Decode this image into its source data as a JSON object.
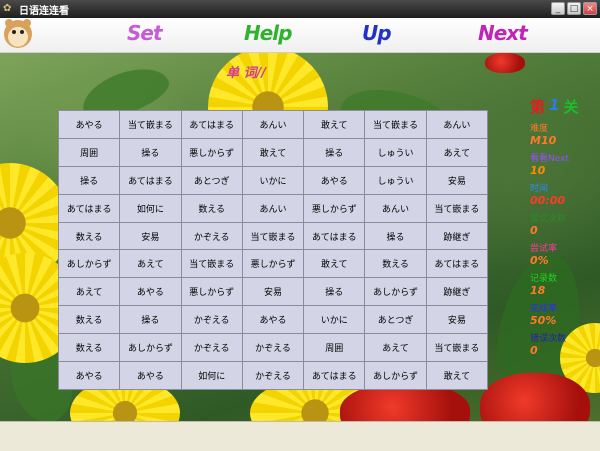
{
  "window": {
    "title": "日语连连看"
  },
  "menu": {
    "set": "Set",
    "help": "Help",
    "up": "Up",
    "next": "Next"
  },
  "heading": "单 词//",
  "grid": [
    [
      "あやる",
      "当て嵌まる",
      "あてはまる",
      "あんい",
      "敢えて",
      "当て嵌まる",
      "あんい"
    ],
    [
      "周囲",
      "操る",
      "悪しからず",
      "敢えて",
      "操る",
      "しゅうい",
      "あえて"
    ],
    [
      "操る",
      "あてはまる",
      "あとつぎ",
      "いかに",
      "あやる",
      "しゅうい",
      "安易"
    ],
    [
      "あてはまる",
      "如何に",
      "数える",
      "あんい",
      "悪しからず",
      "あんい",
      "当て嵌まる"
    ],
    [
      "数える",
      "安易",
      "かぞえる",
      "当て嵌まる",
      "あてはまる",
      "操る",
      "跡継ぎ"
    ],
    [
      "あしからず",
      "あえて",
      "当て嵌まる",
      "悪しからず",
      "敢えて",
      "数える",
      "あてはまる"
    ],
    [
      "あえて",
      "あやる",
      "悪しからず",
      "安易",
      "操る",
      "あしからず",
      "跡継ぎ"
    ],
    [
      "数える",
      "操る",
      "かぞえる",
      "あやる",
      "いかに",
      "あとつぎ",
      "安易"
    ],
    [
      "数える",
      "あしからず",
      "かぞえる",
      "かぞえる",
      "周囲",
      "あえて",
      "当て嵌まる"
    ],
    [
      "あやる",
      "あやる",
      "如何に",
      "かぞえる",
      "あてはまる",
      "あしからず",
      "敢えて"
    ]
  ],
  "panel": {
    "level_prefix": "第",
    "level_num": "1",
    "level_suffix": "关",
    "stats": [
      {
        "label": "难度",
        "value": "M10",
        "label_color": "#ff7a2a",
        "value_color": "#ff7a2a"
      },
      {
        "label": "看看Next",
        "value": "10",
        "label_color": "#9b4dff",
        "value_color": "#ff8c00"
      },
      {
        "label": "时间",
        "value": "00:00",
        "label_color": "#2a8cff",
        "value_color": "#ff3a2a"
      },
      {
        "label": "尝试次数",
        "value": "0",
        "label_color": "#2a8c2a",
        "value_color": "#ff7a2a"
      },
      {
        "label": "尝试率",
        "value": "0%",
        "label_color": "#ff3a9a",
        "value_color": "#ff7a2a"
      },
      {
        "label": "记录数",
        "value": "18",
        "label_color": "#22d022",
        "value_color": "#ff7a2a"
      },
      {
        "label": "完成率",
        "value": "50%",
        "label_color": "#2a2aff",
        "value_color": "#ff7a2a"
      },
      {
        "label": "错误次数",
        "value": "0",
        "label_color": "#2222aa",
        "value_color": "#ff7a2a"
      }
    ]
  }
}
